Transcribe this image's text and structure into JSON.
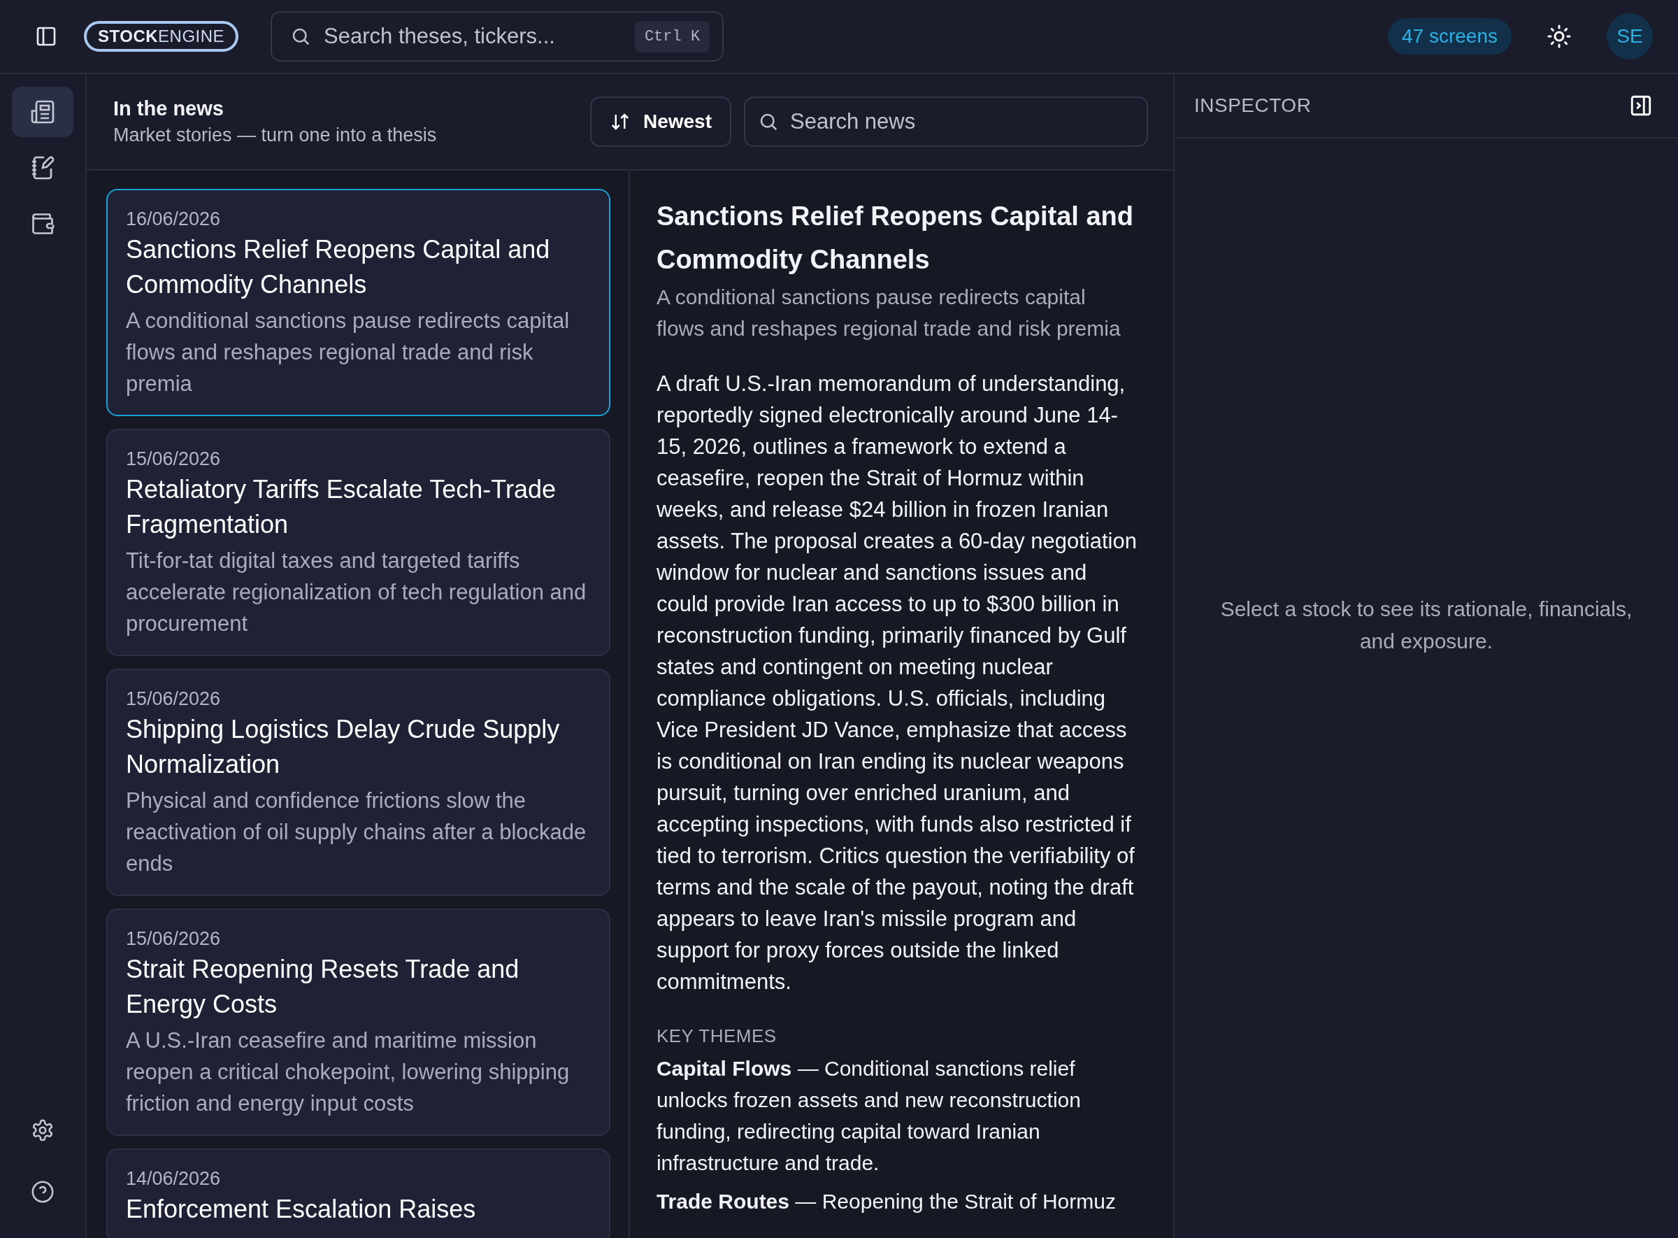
{
  "topbar": {
    "logo": {
      "strong": "STOCK",
      "light": "ENGINE"
    },
    "search": {
      "placeholder": "Search theses, tickers...",
      "shortcut": "Ctrl K"
    },
    "screens_badge": "47 screens",
    "avatar": "SE"
  },
  "rail": {
    "items": [
      {
        "kind": "news",
        "selected": true
      },
      {
        "kind": "notebook",
        "selected": false
      },
      {
        "kind": "wallet",
        "selected": false
      }
    ],
    "footer": [
      {
        "kind": "settings"
      },
      {
        "kind": "help"
      }
    ]
  },
  "news": {
    "title": "In the news",
    "subtitle": "Market stories — turn one into a thesis",
    "sort_button": "Newest",
    "search": {
      "placeholder": "Search news"
    },
    "stories": [
      {
        "date": "16/06/2026",
        "title": "Sanctions Relief Reopens Capital and Commodity Channels",
        "summary": "A conditional sanctions pause redirects capital flows and reshapes regional trade and risk premia",
        "selected": true
      },
      {
        "date": "15/06/2026",
        "title": "Retaliatory Tariffs Escalate Tech-Trade Fragmentation",
        "summary": "Tit-for-tat digital taxes and targeted tariffs accelerate regionalization of tech regulation and procurement",
        "selected": false
      },
      {
        "date": "15/06/2026",
        "title": "Shipping Logistics Delay Crude Supply Normalization",
        "summary": "Physical and confidence frictions slow the reactivation of oil supply chains after a blockade ends",
        "selected": false
      },
      {
        "date": "15/06/2026",
        "title": "Strait Reopening Resets Trade and Energy Costs",
        "summary": "A U.S.-Iran ceasefire and maritime mission reopen a critical chokepoint, lowering shipping friction and energy input costs",
        "selected": false
      },
      {
        "date": "14/06/2026",
        "title": "Enforcement Escalation Raises",
        "selected": false
      }
    ]
  },
  "article": {
    "title": "Sanctions Relief Reopens Capital and Commodity Channels",
    "subtitle": "A conditional sanctions pause redirects capital flows and reshapes regional trade and risk premia",
    "body": "A draft U.S.-Iran memorandum of understanding, reportedly signed electronically around June 14-15, 2026, outlines a framework to extend a ceasefire, reopen the Strait of Hormuz within weeks, and release $24 billion in frozen Iranian assets. The proposal creates a 60-day negotiation window for nuclear and sanctions issues and could provide Iran access to up to $300 billion in reconstruction funding, primarily financed by Gulf states and contingent on meeting nuclear compliance obligations. U.S. officials, including Vice President JD Vance, emphasize that access is conditional on Iran ending its nuclear weapons pursuit, turning over enriched uranium, and accepting inspections, with funds also restricted if tied to terrorism. Critics question the verifiability of terms and the scale of the payout, noting the draft appears to leave Iran's missile program and support for proxy forces outside the linked commitments.",
    "themes_heading": "KEY THEMES",
    "themes": [
      "**Capital Flows** — Conditional sanctions relief unlocks frozen assets and new reconstruction funding, redirecting capital toward Iranian infrastructure and trade.",
      "**Trade Routes** — Reopening the Strait of Hormuz"
    ]
  },
  "inspector": {
    "title": "INSPECTOR",
    "empty_message": "Select a stock to see its rationale, financials, and exposure."
  }
}
